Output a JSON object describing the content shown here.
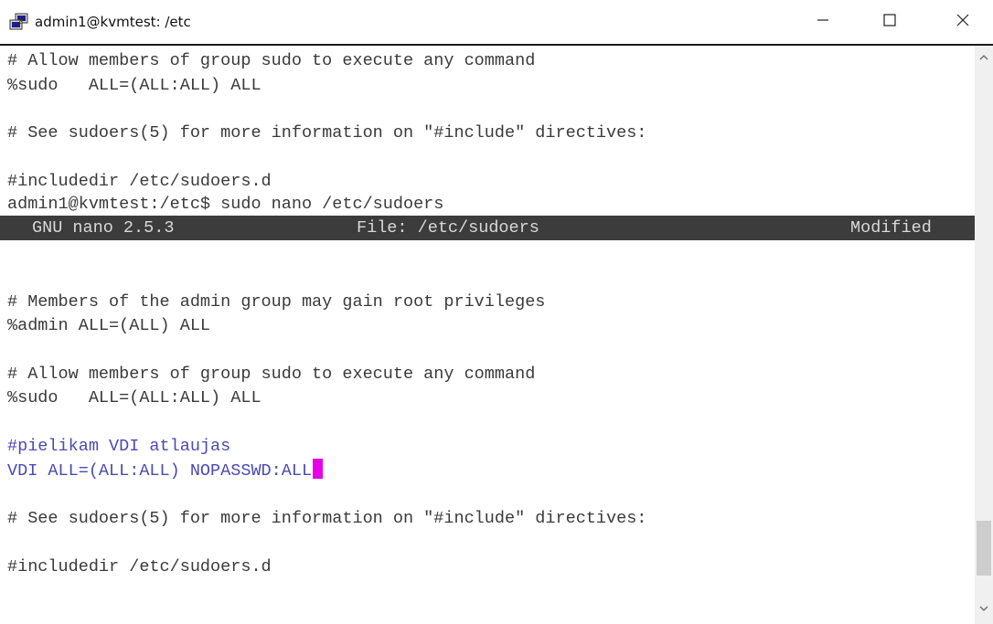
{
  "window": {
    "title": "admin1@kvmtest: /etc",
    "icon": "putty-icon",
    "controls": [
      "minimize-icon",
      "maximize-icon",
      "close-icon"
    ]
  },
  "terminal": {
    "lines_before": [
      "# Allow members of group sudo to execute any command",
      "%sudo   ALL=(ALL:ALL) ALL",
      "",
      "# See sudoers(5) for more information on \"#include\" directives:",
      "",
      "#includedir /etc/sudoers.d",
      "admin1@kvmtest:/etc$ sudo nano /etc/sudoers"
    ],
    "nano_bar": {
      "version": "GNU nano 2.5.3",
      "file": "File: /etc/sudoers",
      "status": "Modified"
    },
    "editor_lines": [
      "# Members of the admin group may gain root privileges",
      "%admin ALL=(ALL) ALL",
      "# Allow members of group sudo to execute any command",
      "%sudo   ALL=(ALL:ALL) ALL",
      "#pielikam VDI atlaujas",
      "VDI ALL=(ALL:ALL) NOPASSWD:ALL",
      "# See sudoers(5) for more information on \"#include\" directives:",
      "#includedir /etc/sudoers.d"
    ]
  },
  "colors": {
    "text": "#3a3a3a",
    "highlight_text": "#4a4ab4",
    "nano_bar_bg": "#3c3c3c",
    "cursor": "#e600e6"
  }
}
